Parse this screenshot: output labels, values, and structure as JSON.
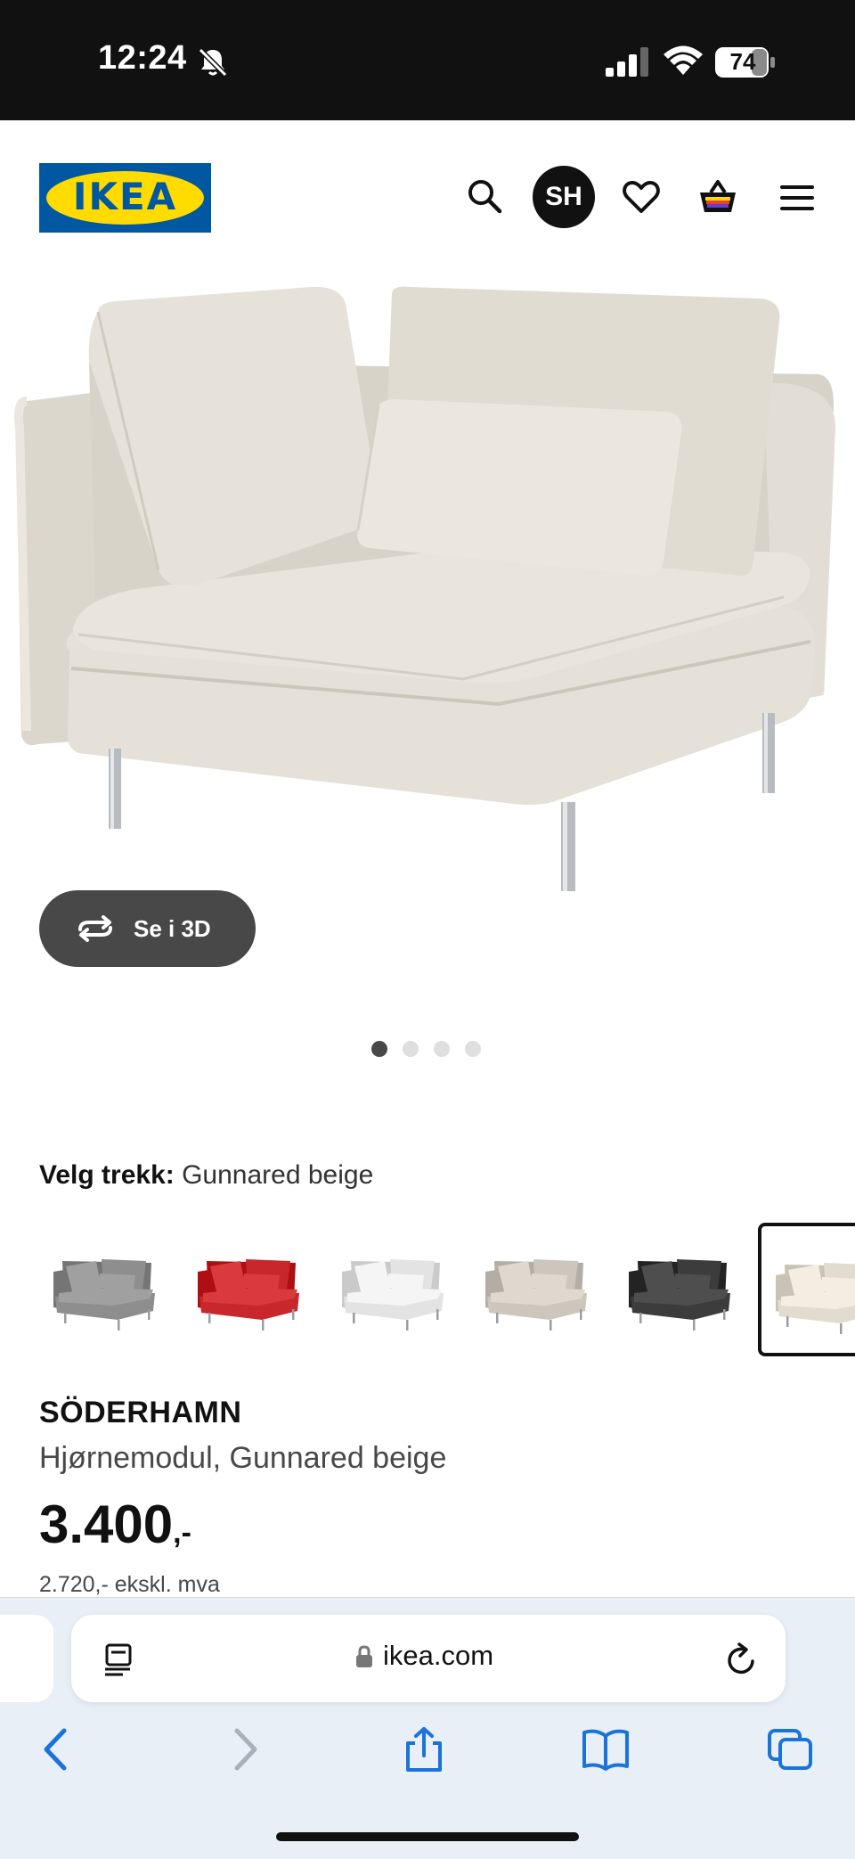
{
  "status_bar": {
    "time": "12:24",
    "battery": "74",
    "bell_icon": "bell-slash-icon",
    "signal_icon": "cellular-signal-icon",
    "wifi_icon": "wifi-icon"
  },
  "header": {
    "logo_text": "IKEA",
    "avatar_initials": "SH",
    "icons": [
      "search-icon",
      "heart-icon",
      "cart-icon",
      "menu-icon"
    ]
  },
  "gallery": {
    "view_3d_label": "Se i 3D",
    "slide_count": 4,
    "active_slide": 1
  },
  "variant": {
    "label": "Velg trekk:",
    "value": "Gunnared beige",
    "swatch_colors": [
      "#8e8e8e",
      "#c8282b",
      "#e3e3e3",
      "#cdc6bc",
      "#3c3c3c",
      "#e2dcd0"
    ],
    "selected_index": 5
  },
  "product": {
    "name": "SÖDERHAMN",
    "description": "Hjørnemodul, Gunnared beige",
    "price": "3.400",
    "price_suffix": ",-",
    "price_ex_vat": "2.720,- ekskl. mva"
  },
  "browser": {
    "url": "ikea.com"
  },
  "colors": {
    "status_bar_bg": "#111111",
    "ikea_blue": "#0058a3",
    "ikea_yellow": "#ffdb00",
    "button_dark": "#484848",
    "browser_bg": "#e9eff7",
    "ios_blue": "#1a73d9"
  }
}
